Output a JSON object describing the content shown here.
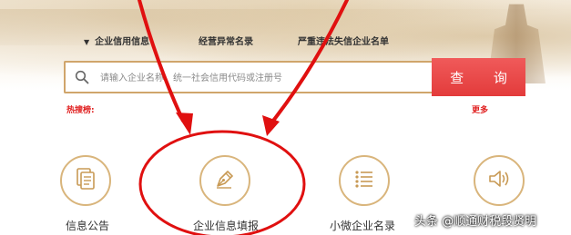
{
  "tabs": [
    {
      "label": "企业信用信息",
      "active": true
    },
    {
      "label": "经营异常名录",
      "active": false
    },
    {
      "label": "严重违法失信企业名单",
      "active": false
    }
  ],
  "search": {
    "placeholder": "请输入企业名称、统一社会信用代码或注册号",
    "button_label": "查 询"
  },
  "hot_label": "热搜榜:",
  "more_label": "更多",
  "tiles": [
    {
      "label": "信息公告",
      "icon": "document-icon"
    },
    {
      "label": "企业信息填报",
      "icon": "pen-icon"
    },
    {
      "label": "小微企业名录",
      "icon": "list-icon"
    },
    {
      "label": "",
      "icon": "speaker-icon"
    }
  ],
  "watermark": "头条 @顺通财税段贤明",
  "colors": {
    "accent_gold": "#d9b57c",
    "search_button": "#e84545",
    "annotation_red": "#e01010"
  }
}
